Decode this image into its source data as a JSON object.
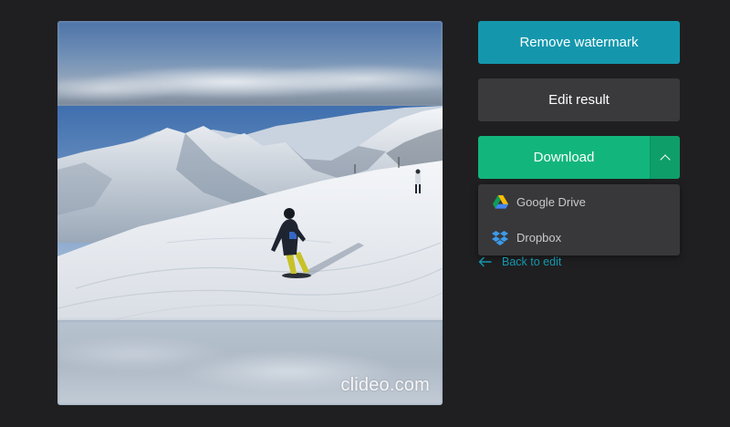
{
  "preview": {
    "watermark_text": "clideo.com"
  },
  "actions": {
    "remove_watermark_label": "Remove watermark",
    "edit_result_label": "Edit result",
    "download_label": "Download",
    "download_menu_open": true,
    "download_options": [
      {
        "label": "Google Drive",
        "icon": "google-drive-icon"
      },
      {
        "label": "Dropbox",
        "icon": "dropbox-icon"
      }
    ],
    "back_label": "Back to edit"
  },
  "colors": {
    "background": "#1f1f21",
    "remove_watermark": "#1497ad",
    "edit_result": "#3a3a3d",
    "download": "#12b67c",
    "download_toggle": "#0e9e6a",
    "dropdown_bg": "#38383b",
    "link": "#1497ad"
  }
}
